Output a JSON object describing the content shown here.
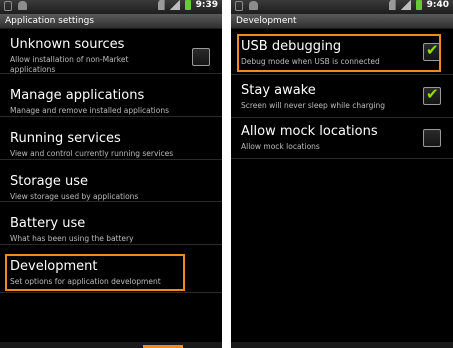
{
  "left": {
    "status": {
      "time": "9:39"
    },
    "title": "Application settings",
    "items": [
      {
        "title": "Unknown sources",
        "subtitle": "Allow installation of non-Market applications",
        "checked": false
      },
      {
        "title": "Manage applications",
        "subtitle": "Manage and remove installed applications"
      },
      {
        "title": "Running services",
        "subtitle": "View and control currently running services"
      },
      {
        "title": "Storage use",
        "subtitle": "View storage used by applications"
      },
      {
        "title": "Battery use",
        "subtitle": "What has been using the battery"
      },
      {
        "title": "Development",
        "subtitle": "Set options for application development",
        "highlighted": true
      }
    ]
  },
  "right": {
    "status": {
      "time": "9:40"
    },
    "title": "Development",
    "items": [
      {
        "title": "USB debugging",
        "subtitle": "Debug mode when USB is connected",
        "checked": true,
        "highlighted": true
      },
      {
        "title": "Stay awake",
        "subtitle": "Screen will never sleep while charging",
        "checked": true
      },
      {
        "title": "Allow mock locations",
        "subtitle": "Allow mock locations",
        "checked": false
      }
    ]
  },
  "colors": {
    "highlight": "#f08a1e",
    "check": "#8ee000",
    "background": "#000000"
  }
}
